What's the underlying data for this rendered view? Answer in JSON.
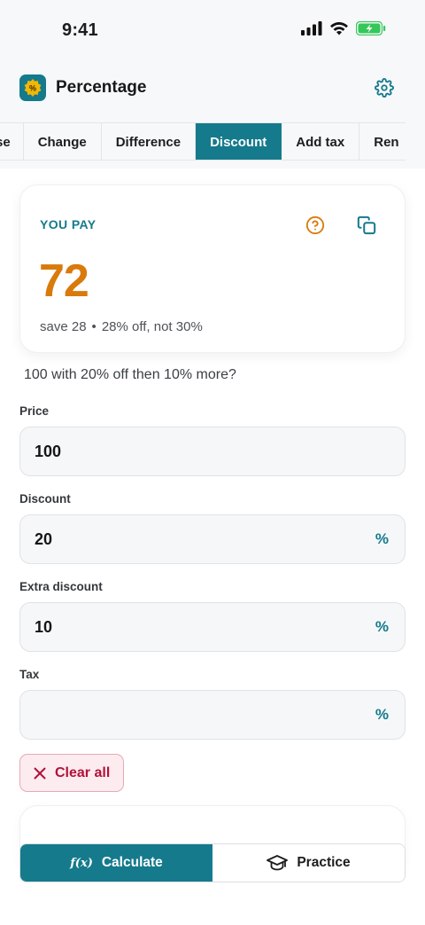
{
  "status": {
    "time": "9:41"
  },
  "app": {
    "title": "Percentage",
    "logo_symbol": "%"
  },
  "tabs": [
    {
      "label": "se",
      "active": false
    },
    {
      "label": "Change",
      "active": false
    },
    {
      "label": "Difference",
      "active": false
    },
    {
      "label": "Discount",
      "active": true
    },
    {
      "label": "Add tax",
      "active": false
    },
    {
      "label": "Ren",
      "active": false
    }
  ],
  "result": {
    "label": "YOU PAY",
    "value": "72",
    "save_text": "save 28",
    "separator": "•",
    "detail_text": "28% off, not 30%"
  },
  "question": "100 with 20% off then 10% more?",
  "fields": {
    "price": {
      "label": "Price",
      "value": "100",
      "suffix": ""
    },
    "discount": {
      "label": "Discount",
      "value": "20",
      "suffix": "%"
    },
    "extra_discount": {
      "label": "Extra discount",
      "value": "10",
      "suffix": "%"
    },
    "tax": {
      "label": "Tax",
      "value": "",
      "suffix": "%"
    }
  },
  "actions": {
    "clear_all": "Clear all"
  },
  "bottom_bar": {
    "calculate_icon_text": "f(x)",
    "calculate_label": "Calculate",
    "practice_label": "Practice"
  },
  "colors": {
    "accent": "#157a8c",
    "result": "#d97a0b",
    "danger": "#b3113a",
    "battery": "#35c759"
  },
  "icons": [
    "signal-icon",
    "wifi-icon",
    "battery-icon",
    "settings-gear-icon",
    "help-circle-icon",
    "copy-icon",
    "close-x-icon",
    "graduation-cap-icon"
  ]
}
